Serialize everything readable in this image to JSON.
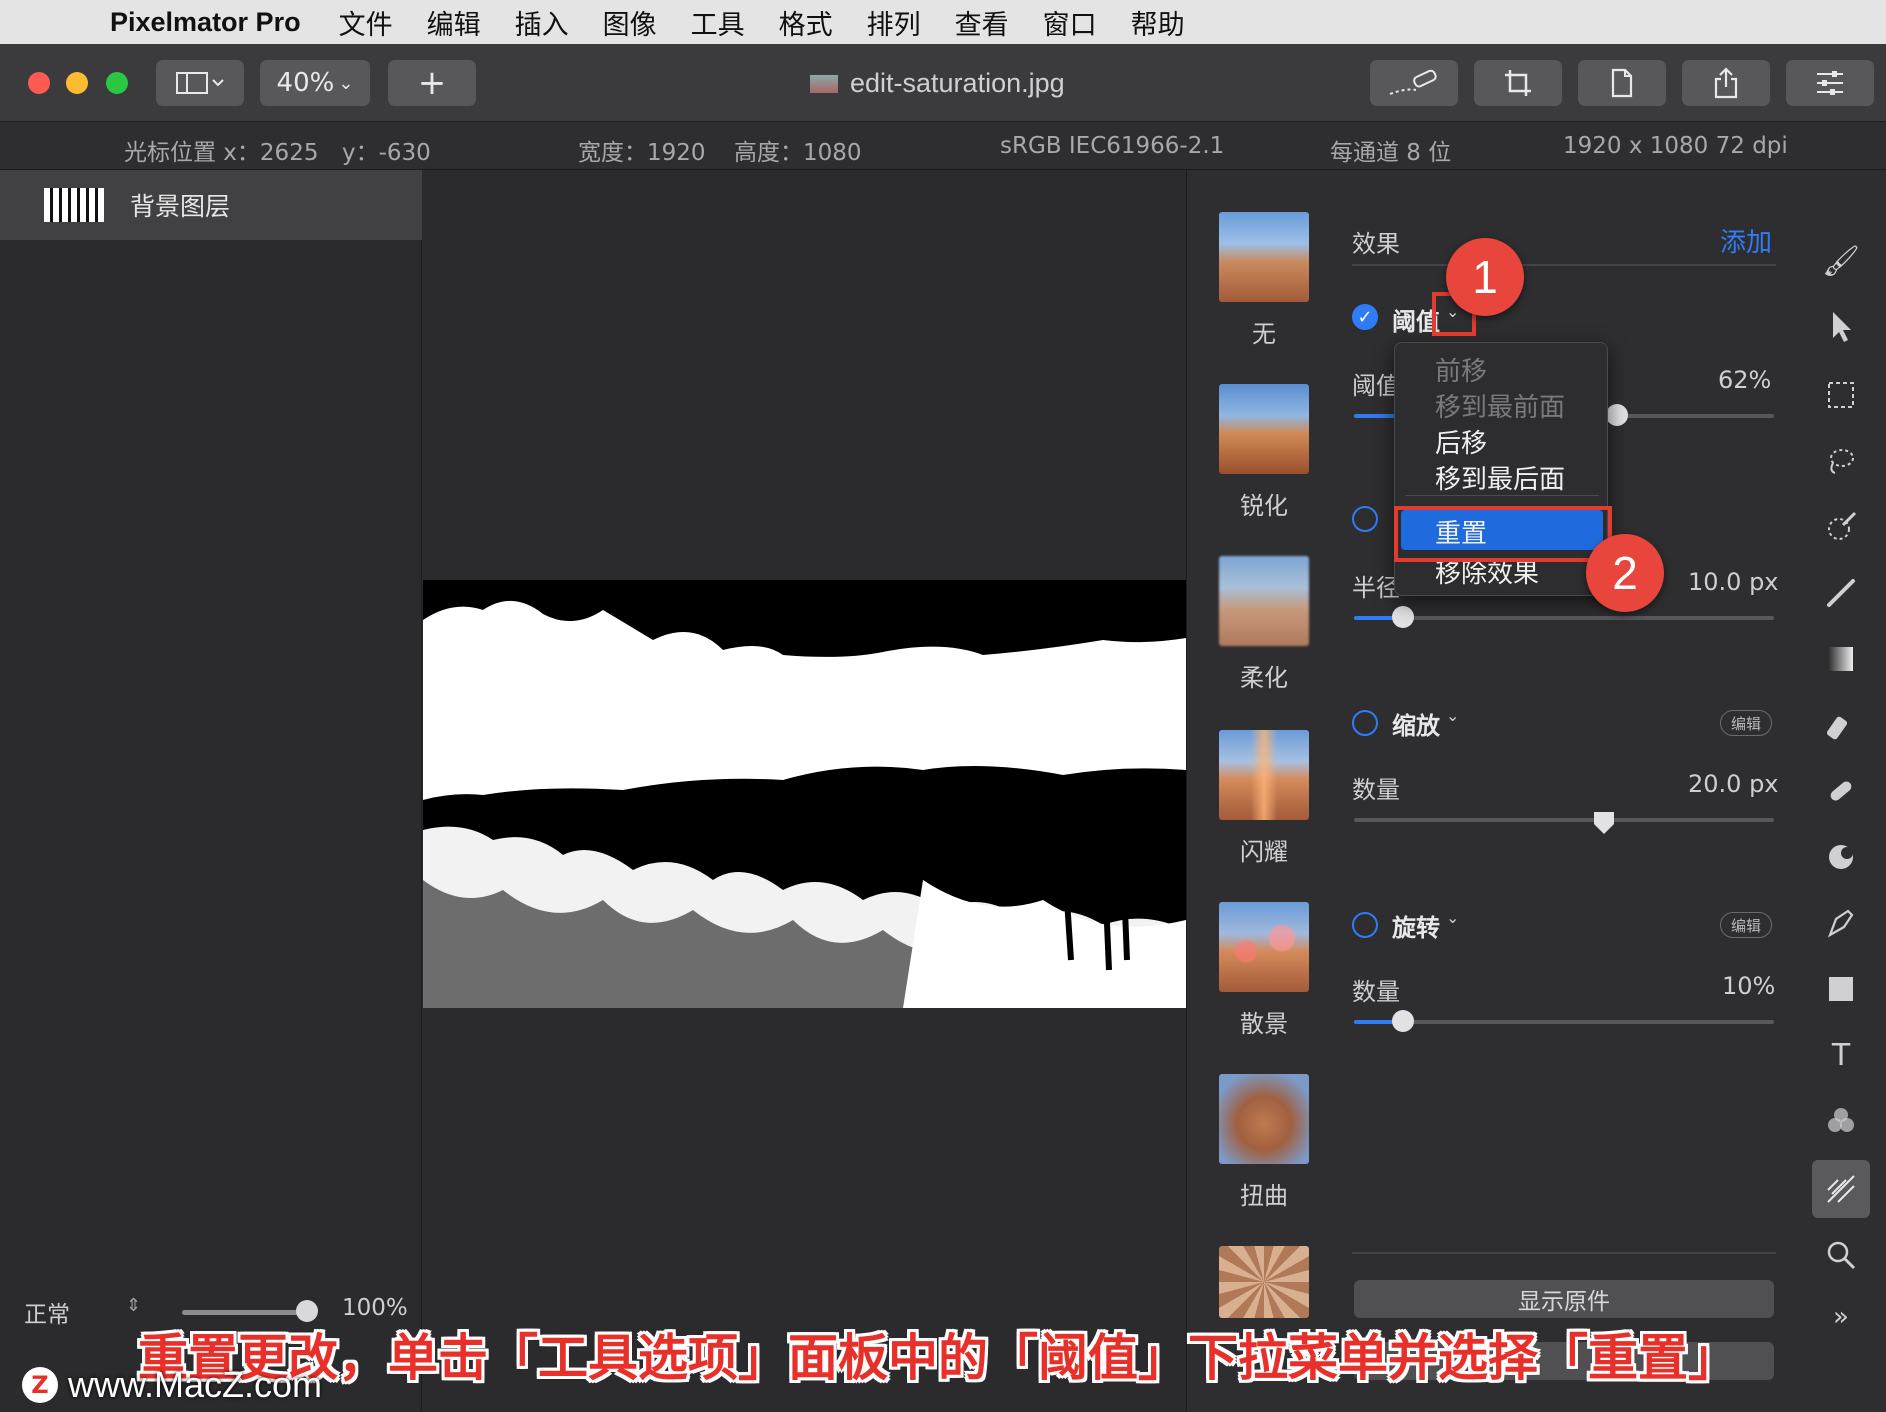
{
  "menubar": {
    "app_name": "Pixelmator Pro",
    "items": [
      "文件",
      "编辑",
      "插入",
      "图像",
      "工具",
      "格式",
      "排列",
      "查看",
      "窗口",
      "帮助"
    ]
  },
  "toolbar": {
    "zoom": "40%",
    "add_label": "+",
    "document_title": "edit-saturation.jpg"
  },
  "infobar": {
    "cursor": "光标位置 x：2625",
    "cursor_y": "y：-630",
    "width": "宽度：1920",
    "height": "高度：1080",
    "profile": "sRGB IEC61966-2.1",
    "depth": "每通道 8 位",
    "resolution": "1920 x 1080 72 dpi"
  },
  "layers": {
    "layer_name": "背景图层",
    "blend_mode": "正常",
    "opacity": "100%",
    "opacity_fraction": 1.0
  },
  "effects_browser": {
    "items": [
      {
        "label": "无"
      },
      {
        "label": "锐化"
      },
      {
        "label": "柔化"
      },
      {
        "label": "闪耀"
      },
      {
        "label": "散景"
      },
      {
        "label": "扭曲"
      }
    ]
  },
  "options": {
    "section_title": "效果",
    "add_label": "添加",
    "effects": [
      {
        "name": "阈值",
        "enabled": true,
        "param_label": "阈值",
        "param_value": "62%",
        "fraction": 0.62
      },
      {
        "name": "",
        "enabled": false,
        "param_label": "半径",
        "param_value": "10.0 px",
        "fraction": 0.12
      },
      {
        "name": "缩放",
        "enabled": false,
        "edit_label": "编辑",
        "param_label": "数量",
        "param_value": "20.0 px",
        "fraction": 0.59
      },
      {
        "name": "旋转",
        "enabled": false,
        "edit_label": "编辑",
        "param_label": "数量",
        "param_value": "10%",
        "fraction": 0.12
      }
    ],
    "show_original_label": "显示原件"
  },
  "dropdown_menu": {
    "items": [
      {
        "label": "前移",
        "enabled": false
      },
      {
        "label": "移到最前面",
        "enabled": false
      },
      {
        "label": "后移",
        "enabled": true
      },
      {
        "label": "移到最后面",
        "enabled": true
      },
      {
        "label": "重置",
        "enabled": true,
        "selected": true
      },
      {
        "label": "移除效果",
        "enabled": true
      }
    ]
  },
  "annotations": {
    "badge1": "1",
    "badge2": "2",
    "caption": "重置更改，单击「工具选项」面板中的「阈值」下拉菜单并选择「重置」",
    "watermark": "www.MacZ.com",
    "watermark_logo": "Z"
  },
  "colors": {
    "accent": "#2f7cf6",
    "annotation_red": "#e8453c",
    "menu_selection": "#1f6bde"
  }
}
